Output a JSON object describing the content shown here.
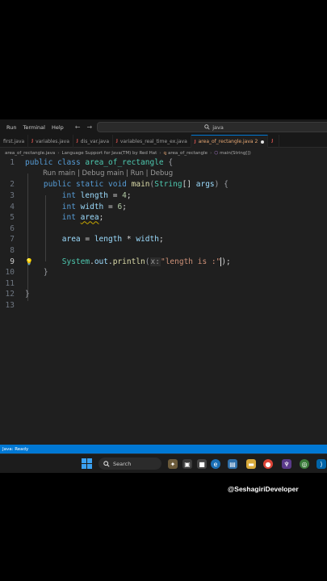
{
  "menubar": {
    "items": [
      "Run",
      "Terminal",
      "Help"
    ],
    "search_text": "java"
  },
  "tabs": [
    {
      "label": "first.java",
      "active": false
    },
    {
      "label": "variables.java",
      "active": false
    },
    {
      "label": "dis_var.java",
      "active": false
    },
    {
      "label": "variables_real_time_ex.java",
      "active": false
    },
    {
      "label": "area_of_rectangle.java 2",
      "active": true
    },
    {
      "label": "J",
      "active": false
    }
  ],
  "breadcrumb": {
    "file": "area_of_rectangle.java",
    "project": "Language Support for Java(TM) by Red Hat",
    "class": "area_of_rectangle",
    "method": "main(String[])"
  },
  "code": {
    "lines": [
      "1",
      "2",
      "3",
      "4",
      "5",
      "6",
      "7",
      "8",
      "9",
      "10",
      "11",
      "12",
      "13"
    ],
    "current_line": "9",
    "codelens": "Run main | Debug main | Run | Debug",
    "l1": {
      "kw1": "public",
      "kw2": "class",
      "name": "area_of_rectangle",
      "brace": "{"
    },
    "l2": {
      "kw1": "public",
      "kw2": "static",
      "kw3": "void",
      "fn": "main",
      "type": "String",
      "args": "args"
    },
    "l3": {
      "type": "int",
      "var": "length",
      "op": " = ",
      "num": "4",
      "end": ";"
    },
    "l4": {
      "type": "int",
      "var": "width",
      "op": " = ",
      "num": "6",
      "end": ";"
    },
    "l5": {
      "type": "int",
      "var": "area",
      "end": ";"
    },
    "l7": {
      "var1": "area",
      "op1": " = ",
      "var2": "length",
      "op2": " * ",
      "var3": "width",
      "end": ";"
    },
    "l9": {
      "cls": "System",
      "field": "out",
      "fn": "println",
      "hint": "x:",
      "str": "\"length is :\"",
      "end": ");"
    },
    "l10": {
      "brace": "}"
    },
    "l12": {
      "brace": "}"
    }
  },
  "status": {
    "text": "Java: Ready"
  },
  "taskbar": {
    "search_label": "Search"
  },
  "watermark": "@SeshagiriDeveloper",
  "colors": {
    "statusbar": "#0078d4",
    "keyword": "#569cd6",
    "type": "#4ec9b0",
    "string": "#ce9178",
    "variable": "#9cdcfe"
  }
}
